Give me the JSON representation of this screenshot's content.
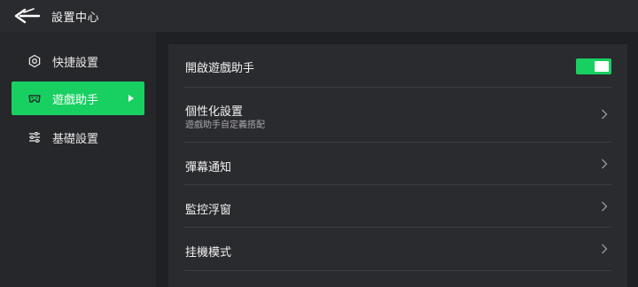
{
  "header": {
    "title": "設置中心",
    "back_icon": "back-arrow-icon"
  },
  "sidebar": {
    "items": [
      {
        "label": "快捷設置",
        "icon": "hexagon-nut-icon",
        "active": false
      },
      {
        "label": "遊戲助手",
        "icon": "gamepad-icon",
        "active": true
      },
      {
        "label": "基礎設置",
        "icon": "sliders-icon",
        "active": false
      }
    ]
  },
  "main": {
    "rows": [
      {
        "title": "開啟遊戲助手",
        "control": "toggle",
        "enabled": true
      },
      {
        "title": "個性化設置",
        "subtitle": "遊戲助手自定義搭配",
        "control": "chevron-right-icon"
      },
      {
        "title": "彈幕通知",
        "control": "chevron-right-icon"
      },
      {
        "title": "監控浮窗",
        "control": "chevron-right-icon"
      },
      {
        "title": "挂機模式",
        "control": "chevron-right-icon"
      }
    ]
  },
  "colors": {
    "accent": "#18d061",
    "background": "#1f2023",
    "panel": "#2a2b2f",
    "sidebar": "#26272b",
    "divider": "#3d3e43"
  }
}
